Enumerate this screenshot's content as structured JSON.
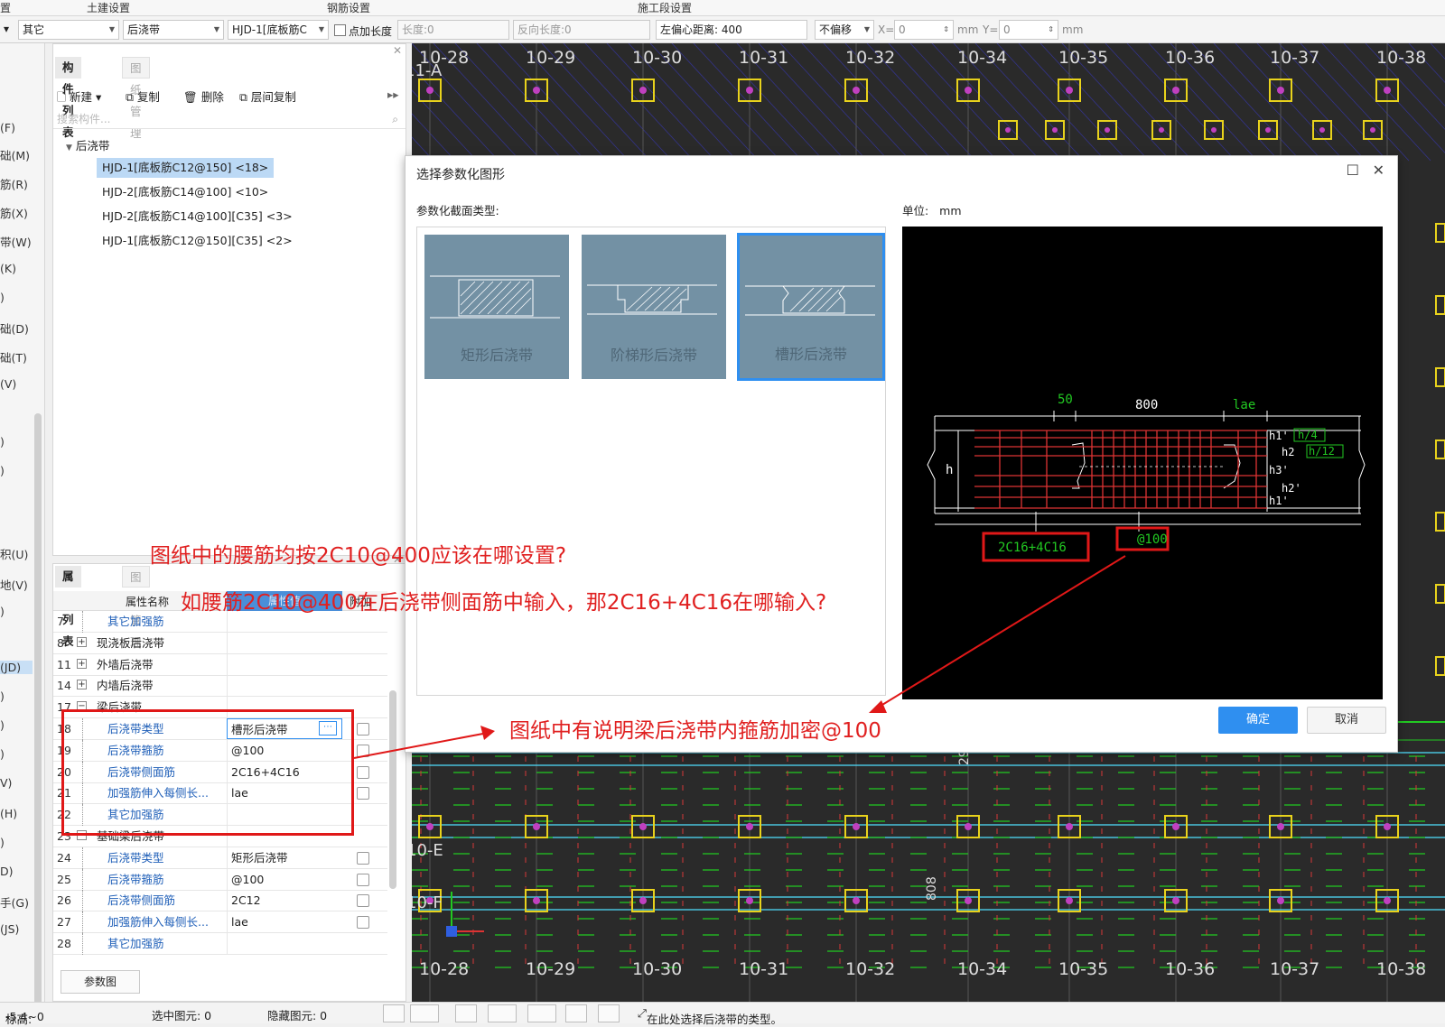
{
  "ribbon": {
    "section1": "土建设置",
    "section2": "钢筋设置",
    "section3": "施工段设置"
  },
  "toolbar": {
    "category": "其它",
    "type": "后浇带",
    "component": "HJD-1[底板筋C",
    "add_length_label": "点加长度",
    "length_label": "长度:",
    "length_value": "0",
    "reverse_length_label": "反向长度:",
    "reverse_length_value": "0",
    "offset_label": "左偏心距离:",
    "offset_value": "400",
    "shift_mode": "不偏移",
    "x_label": "X=",
    "x_value": "0",
    "mm1": "mm",
    "y_label": "Y=",
    "y_value": "0",
    "mm2": "mm"
  },
  "left_strip": [
    "(F)",
    "础(M)",
    "筋(R)",
    "筋(X)",
    "带(W)",
    "(K)",
    ")",
    "础(D)",
    "础(T)",
    "(V)",
    ")",
    ")",
    "积(U)",
    "地(V)",
    ")",
    "(JD)",
    ")",
    ")",
    ")",
    "V)",
    "(H)",
    ")",
    "D)",
    "手(G)",
    "(JS)"
  ],
  "component_panel": {
    "tab_active": "构件列表",
    "tab_inactive": "图纸管理",
    "btn_new": "新建",
    "btn_copy": "复制",
    "btn_delete": "删除",
    "btn_floor_copy": "层间复制",
    "search_placeholder": "搜索构件...",
    "tree_root": "后浇带",
    "tree_items": [
      "HJD-1[底板筋C12@150] <18>",
      "HJD-2[底板筋C14@100] <10>",
      "HJD-2[底板筋C14@100][C35] <3>",
      "HJD-1[底板筋C12@150][C35] <2>"
    ]
  },
  "property_panel": {
    "tab_active": "属性列表",
    "tab_inactive": "图层管理",
    "col_name": "属性名称",
    "col_value": "属性值",
    "col_extra": "附加",
    "rows": [
      {
        "num": "7",
        "name": "其它加强筋",
        "value": "",
        "kind": "sub",
        "chk": false
      },
      {
        "num": "8",
        "name": "现浇板后浇带",
        "value": "",
        "kind": "grp",
        "exp": "+",
        "chk": false
      },
      {
        "num": "11",
        "name": "外墙后浇带",
        "value": "",
        "kind": "grp",
        "exp": "+",
        "chk": false
      },
      {
        "num": "14",
        "name": "内墙后浇带",
        "value": "",
        "kind": "grp",
        "exp": "+",
        "chk": false
      },
      {
        "num": "17",
        "name": "梁后浇带",
        "value": "",
        "kind": "grp",
        "exp": "−",
        "chk": false
      },
      {
        "num": "18",
        "name": "后浇带类型",
        "value": "槽形后浇带",
        "kind": "sub",
        "chk": true,
        "editing": true
      },
      {
        "num": "19",
        "name": "后浇带箍筋",
        "value": "@100",
        "kind": "sub",
        "chk": true
      },
      {
        "num": "20",
        "name": "后浇带侧面筋",
        "value": "2C16+4C16",
        "kind": "sub",
        "chk": true
      },
      {
        "num": "21",
        "name": "加强筋伸入每侧长...",
        "value": "lae",
        "kind": "sub",
        "chk": true
      },
      {
        "num": "22",
        "name": "其它加强筋",
        "value": "",
        "kind": "sub",
        "chk": false
      },
      {
        "num": "23",
        "name": "基础梁后浇带",
        "value": "",
        "kind": "grp",
        "exp": "−",
        "chk": false
      },
      {
        "num": "24",
        "name": "后浇带类型",
        "value": "矩形后浇带",
        "kind": "sub",
        "chk": true
      },
      {
        "num": "25",
        "name": "后浇带箍筋",
        "value": "@100",
        "kind": "sub",
        "chk": true
      },
      {
        "num": "26",
        "name": "后浇带侧面筋",
        "value": "2C12",
        "kind": "sub",
        "chk": true
      },
      {
        "num": "27",
        "name": "加强筋伸入每侧长...",
        "value": "lae",
        "kind": "sub",
        "chk": true
      },
      {
        "num": "28",
        "name": "其它加强筋",
        "value": "",
        "kind": "sub",
        "chk": false
      }
    ],
    "param_button": "参数图"
  },
  "cad": {
    "top_axis": [
      "10-28",
      "10-29",
      "10-30",
      "10-31",
      "10-32",
      "10-34",
      "10-35",
      "10-36",
      "10-37",
      "10-38"
    ],
    "bottom_axis": [
      "10-28",
      "10-29",
      "10-30",
      "10-31",
      "10-32",
      "10-34",
      "10-35",
      "10-36",
      "10-37",
      "10-38"
    ],
    "row_label_top": "11-A",
    "row_label_mid": "10-E",
    "row_label_low": "10-F",
    "dim_text": "808",
    "dim_text2": "29",
    "colors": {
      "bg": "#2a2a2a",
      "grid": "#4fe0ff",
      "column": "#e8d21c",
      "red": "#d73838",
      "green": "#22c922"
    }
  },
  "dialog": {
    "title": "选择参数化图形",
    "section_label": "参数化截面类型:",
    "unit_label": "单位:",
    "unit_value": "mm",
    "types": [
      {
        "label": "矩形后浇带",
        "selected": false
      },
      {
        "label": "阶梯形后浇带",
        "selected": false
      },
      {
        "label": "槽形后浇带",
        "selected": true
      }
    ],
    "preview": {
      "dim_50": "50",
      "dim_800": "800",
      "dim_lae": "lae",
      "h": "h",
      "h1p": "h1'",
      "h4": "h/4",
      "h2": "h2",
      "h12": "h/12",
      "h3p": "h3'",
      "h2p": "h2'",
      "h1": "h1'",
      "rebar_side": "2C16+4C16",
      "stirrup": "@100"
    },
    "ok": "确定",
    "cancel": "取消"
  },
  "annotations": {
    "q1": "图纸中的腰筋均按2C10@400应该在哪设置?",
    "q2": "如腰筋2C10@400在后浇带侧面筋中输入，那2C16+4C16在哪输入?",
    "note": "图纸中有说明梁后浇带内箍筋加密@100"
  },
  "status": {
    "elev_label": "标高:",
    "elev_value": "-5.4~0",
    "selected": "选中图元: 0",
    "hidden": "隐藏图元: 0",
    "hint": "在此处选择后浇带的类型。"
  }
}
